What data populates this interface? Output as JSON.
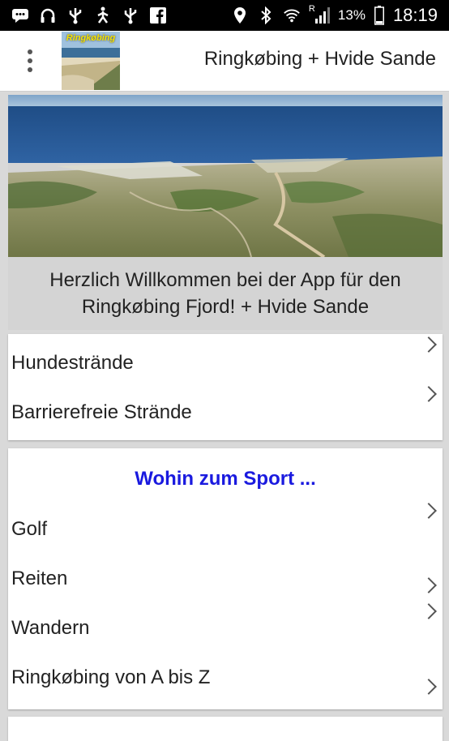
{
  "status_bar": {
    "icons_left": [
      "chat-icon",
      "headset-icon",
      "usb-icon",
      "pedometer-icon",
      "usb-icon",
      "facebook-icon"
    ],
    "icons_right": [
      "location-icon",
      "bluetooth-icon",
      "wifi-icon",
      "signal-icon"
    ],
    "battery_percent": "13%",
    "time": "18:19",
    "signal_roaming": "R"
  },
  "app_bar": {
    "logo_text": "Ringkøbing",
    "title": "Ringkøbing + Hvide Sande"
  },
  "hero": {
    "caption": "Herzlich Willkommen bei der App für den Ringkøbing Fjord! + Hvide Sande"
  },
  "beaches": {
    "items": [
      {
        "label": "Hundestrände"
      },
      {
        "label": "Barrierefreie Strände"
      }
    ]
  },
  "sport": {
    "heading": "Wohin zum Sport ...",
    "items": [
      {
        "label": "Golf"
      },
      {
        "label": "Reiten"
      },
      {
        "label": "Wandern"
      },
      {
        "label": "Ringkøbing von A bis Z"
      }
    ]
  },
  "colors": {
    "heading_blue": "#1a1adf",
    "status_bar": "#000000",
    "background": "#d9d9d9"
  }
}
